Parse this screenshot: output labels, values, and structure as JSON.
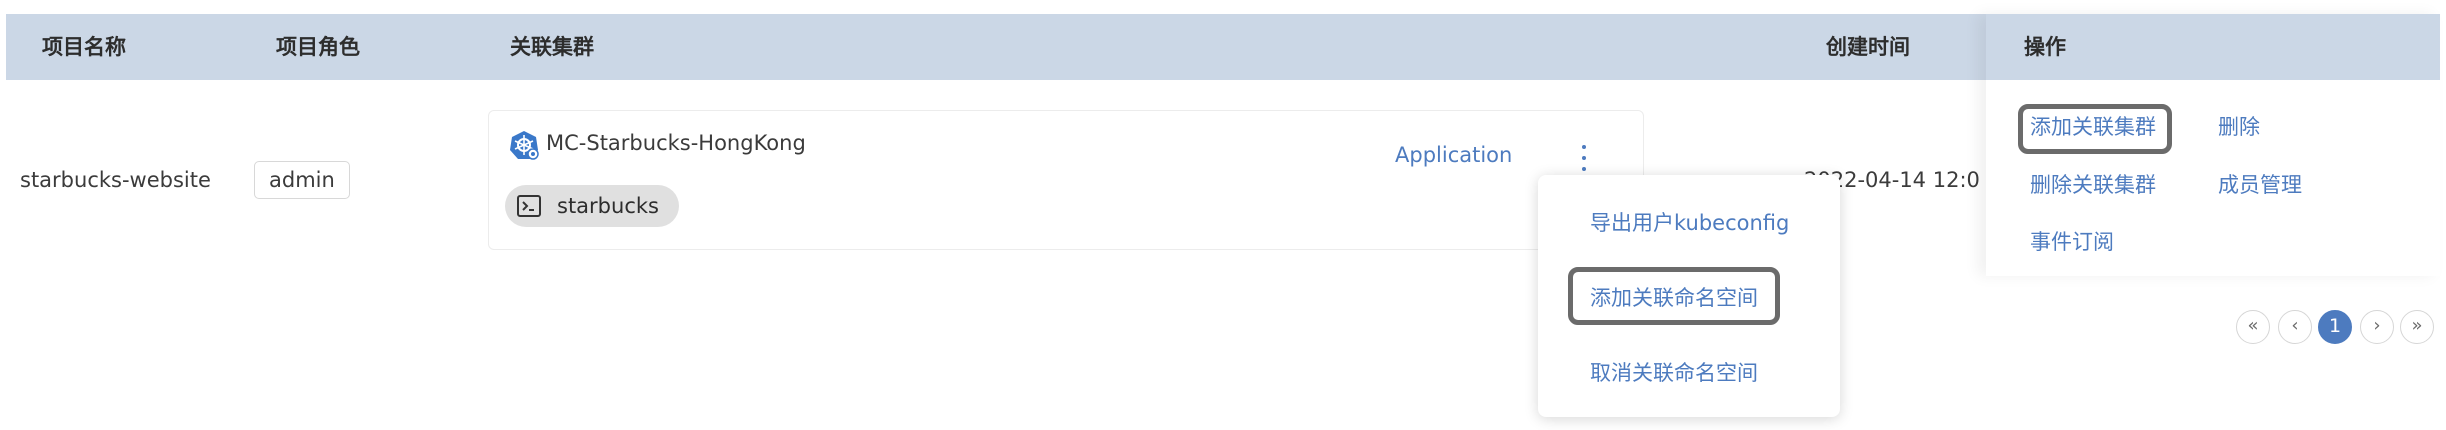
{
  "table": {
    "headers": {
      "name": "项目名称",
      "role": "项目角色",
      "cluster": "关联集群",
      "created": "创建时间",
      "ops": "操作"
    },
    "row": {
      "project_name": "starbucks-website",
      "role": "admin",
      "cluster_name": "MC-Starbucks-HongKong",
      "namespace": "starbucks",
      "app_link": "Application",
      "created_time": "2022-04-14 12:0"
    }
  },
  "operations": {
    "add_cluster": "添加关联集群",
    "delete": "删除",
    "remove_cluster": "删除关联集群",
    "members": "成员管理",
    "event_subscribe": "事件订阅"
  },
  "dropdown": {
    "export_kubeconfig": "导出用户kubeconfig",
    "add_namespace": "添加关联命名空间",
    "remove_namespace": "取消关联命名空间"
  },
  "pagination": {
    "first": "«",
    "prev": "‹",
    "current": "1",
    "next": "›",
    "last": "»"
  },
  "colors": {
    "header_bg": "#cbd7e6",
    "link": "#4d7bbf",
    "highlight_border": "#6b6b6b"
  }
}
